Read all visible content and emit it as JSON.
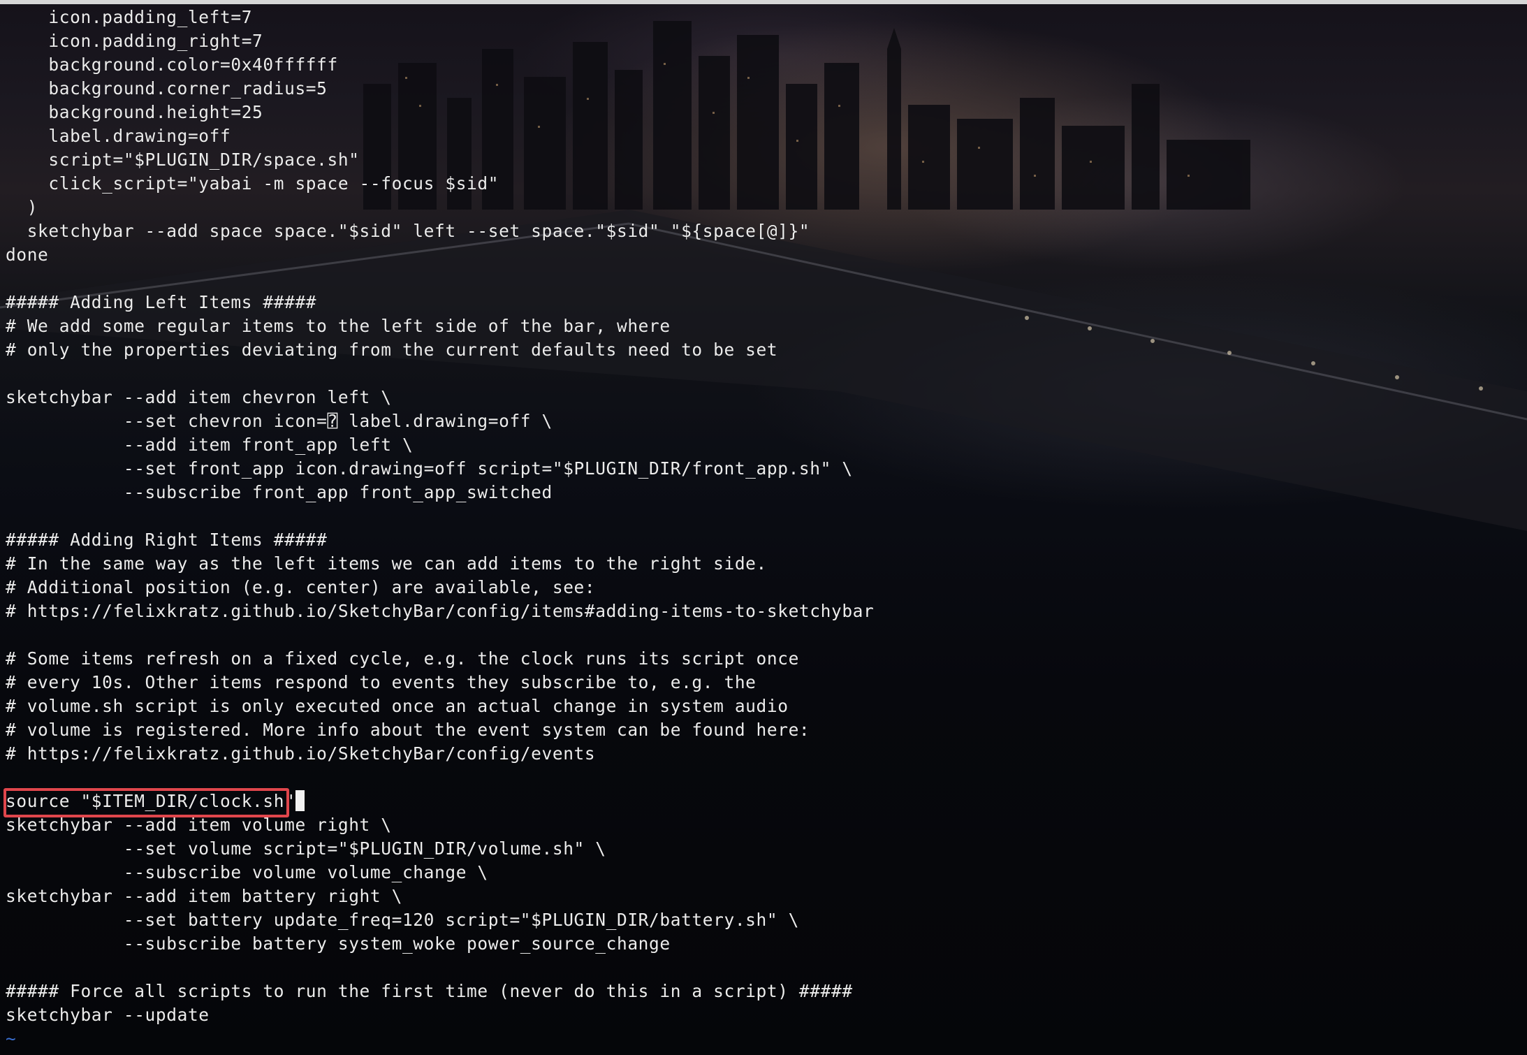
{
  "terminal": {
    "lines": [
      "    icon.padding_left=7",
      "    icon.padding_right=7",
      "    background.color=0x40ffffff",
      "    background.corner_radius=5",
      "    background.height=25",
      "    label.drawing=off",
      "    script=\"$PLUGIN_DIR/space.sh\"",
      "    click_script=\"yabai -m space --focus $sid\"",
      "  )",
      "  sketchybar --add space space.\"$sid\" left --set space.\"$sid\" \"${space[@]}\"",
      "done",
      "",
      "##### Adding Left Items #####",
      "# We add some regular items to the left side of the bar, where",
      "# only the properties deviating from the current defaults need to be set",
      "",
      "sketchybar --add item chevron left \\",
      "           --set chevron icon=⍰ label.drawing=off \\",
      "           --add item front_app left \\",
      "           --set front_app icon.drawing=off script=\"$PLUGIN_DIR/front_app.sh\" \\",
      "           --subscribe front_app front_app_switched",
      "",
      "##### Adding Right Items #####",
      "# In the same way as the left items we can add items to the right side.",
      "# Additional position (e.g. center) are available, see:",
      "# https://felixkratz.github.io/SketchyBar/config/items#adding-items-to-sketchybar",
      "",
      "# Some items refresh on a fixed cycle, e.g. the clock runs its script once",
      "# every 10s. Other items respond to events they subscribe to, e.g. the",
      "# volume.sh script is only executed once an actual change in system audio",
      "# volume is registered. More info about the event system can be found here:",
      "# https://felixkratz.github.io/SketchyBar/config/events",
      "",
      "source \"$ITEM_DIR/clock.sh\"",
      "sketchybar --add item volume right \\",
      "           --set volume script=\"$PLUGIN_DIR/volume.sh\" \\",
      "           --subscribe volume volume_change \\",
      "sketchybar --add item battery right \\",
      "           --set battery update_freq=120 script=\"$PLUGIN_DIR/battery.sh\" \\",
      "           --subscribe battery system_woke power_source_change",
      "",
      "##### Force all scripts to run the first time (never do this in a script) #####",
      "sketchybar --update",
      "~"
    ],
    "cursor_line_index": 33,
    "colors": {
      "text": "#ececec",
      "tilde": "#3a6fd0",
      "highlight_border": "#e0464c",
      "cursor": "#f2f2f2"
    }
  }
}
